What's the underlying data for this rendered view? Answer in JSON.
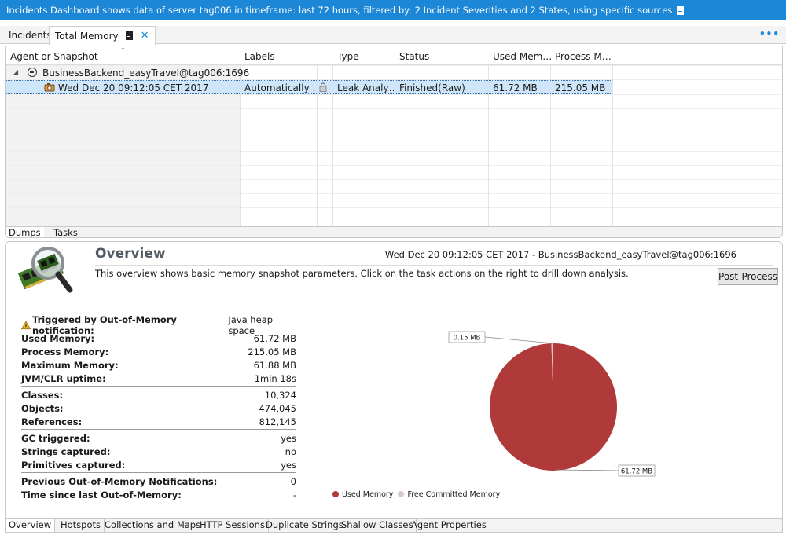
{
  "banner": {
    "text": "Incidents Dashboard shows data of server tag006 in timeframe: last 72 hours, filtered by: 2 Incident Severities and 2 States, using specific sources"
  },
  "editor_tabs": [
    {
      "label": "Incidents"
    },
    {
      "label": "Total Memory"
    }
  ],
  "table": {
    "columns": [
      "Agent or Snapshot",
      "Labels",
      "Type",
      "Status",
      "Used Mem…",
      "Process M…"
    ],
    "agent": "BusinessBackend_easyTravel@tag006:1696",
    "snapshot": {
      "name": "Wed Dec 20 09:12:05 CET 2017",
      "labels": "Automatically …",
      "type": "Leak Analy…",
      "status": "Finished(Raw)",
      "used_memory": "61.72 MB",
      "process_memory": "215.05 MB"
    }
  },
  "upper_bottom_tabs": [
    "Dumps",
    "Tasks"
  ],
  "overview": {
    "title": "Overview",
    "timestamp_source": "Wed Dec 20 09:12:05 CET 2017 - BusinessBackend_easyTravel@tag006:1696",
    "description": "This overview shows basic memory snapshot parameters. Click on the task actions on the right to drill down analysis.",
    "post_process_label": "Post-Process",
    "oom_label": "Triggered by Out-of-Memory notification:",
    "oom_value": "Java heap space",
    "groups": [
      [
        {
          "k": "Used Memory:",
          "v": "61.72 MB"
        },
        {
          "k": "Process Memory:",
          "v": "215.05 MB"
        },
        {
          "k": "Maximum Memory:",
          "v": "61.88 MB"
        },
        {
          "k": "JVM/CLR uptime:",
          "v": "1min 18s"
        }
      ],
      [
        {
          "k": "Classes:",
          "v": "10,324"
        },
        {
          "k": "Objects:",
          "v": "474,045"
        },
        {
          "k": "References:",
          "v": "812,145"
        }
      ],
      [
        {
          "k": "GC triggered:",
          "v": "yes"
        },
        {
          "k": "Strings captured:",
          "v": "no"
        },
        {
          "k": "Primitives captured:",
          "v": "yes"
        }
      ],
      [
        {
          "k": "Previous Out-of-Memory Notifications:",
          "v": "0"
        },
        {
          "k": "Time since last Out-of-Memory:",
          "v": "-"
        }
      ]
    ]
  },
  "chart_data": {
    "type": "pie",
    "slices": [
      {
        "name": "Used Memory",
        "value": 61.72,
        "label": "61.72 MB",
        "color": "#b03a3a"
      },
      {
        "name": "Free Committed Memory",
        "value": 0.15,
        "label": "0.15 MB",
        "color": "#d9c9c4"
      }
    ],
    "legend": [
      "Used Memory",
      "Free Committed Memory"
    ],
    "legend_position": "bottom"
  },
  "lower_bottom_tabs": [
    "Overview",
    "Hotspots",
    "Collections and Maps",
    "HTTP Sessions",
    "Duplicate Strings",
    "Shallow Classes",
    "Agent Properties"
  ],
  "colors": {
    "banner": "#1c87d6",
    "selection": "#cfe6fa",
    "used_memory": "#b03a3a",
    "free_memory": "#d9c9c4"
  }
}
